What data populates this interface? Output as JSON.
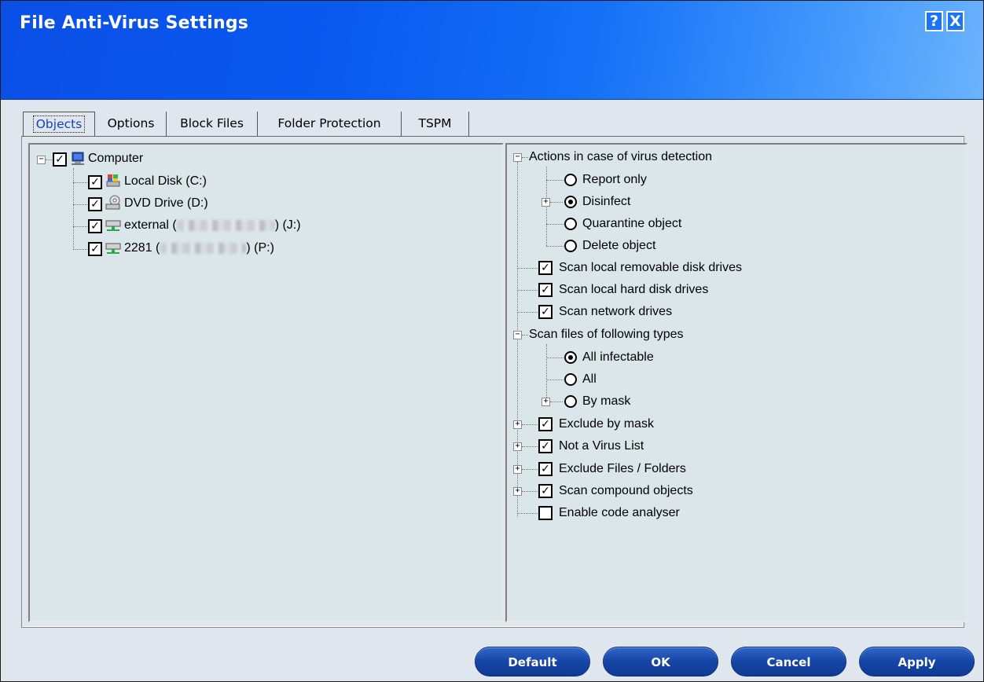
{
  "window": {
    "title": "File Anti-Virus Settings",
    "help_label": "?",
    "close_label": "X"
  },
  "tabs": [
    "Objects",
    "Options",
    "Block Files",
    "Folder Protection",
    "TSPM"
  ],
  "selected_tab": "Objects",
  "objects_tree": {
    "root": {
      "label": "Computer",
      "checked": true,
      "icon": "computer-icon"
    },
    "items": [
      {
        "label": "Local Disk (C:)",
        "checked": true,
        "icon": "local-disk-icon"
      },
      {
        "label": "DVD Drive (D:)",
        "checked": true,
        "icon": "dvd-drive-icon"
      },
      {
        "label_prefix": "external (",
        "label_suffix": ") (J:)",
        "checked": true,
        "icon": "network-drive-icon",
        "blurred": true
      },
      {
        "label_prefix": "2281 (",
        "label_suffix": ") (P:)",
        "checked": true,
        "icon": "network-drive-icon",
        "blurred": true
      }
    ]
  },
  "options_tree": {
    "actions": {
      "label": "Actions in case of virus detection",
      "options": [
        {
          "label": "Report only",
          "selected": false
        },
        {
          "label": "Disinfect",
          "selected": true,
          "expandable": true
        },
        {
          "label": "Quarantine object",
          "selected": false
        },
        {
          "label": "Delete object",
          "selected": false
        }
      ]
    },
    "scan_removable": {
      "label": "Scan local removable disk drives",
      "checked": true
    },
    "scan_hard": {
      "label": "Scan local hard disk drives",
      "checked": true
    },
    "scan_network": {
      "label": "Scan network drives",
      "checked": true
    },
    "file_types": {
      "label": "Scan files of following types",
      "options": [
        {
          "label": "All infectable",
          "selected": true
        },
        {
          "label": "All",
          "selected": false
        },
        {
          "label": "By mask",
          "selected": false,
          "expandable": true
        }
      ]
    },
    "exclude_mask": {
      "label": "Exclude by mask",
      "checked": true
    },
    "not_virus": {
      "label": "Not a Virus List",
      "checked": true
    },
    "exclude_files": {
      "label": "Exclude Files / Folders",
      "checked": true
    },
    "compound": {
      "label": "Scan compound objects",
      "checked": true
    },
    "code_analyser": {
      "label": "Enable code analyser",
      "checked": false
    }
  },
  "buttons": {
    "default": "Default",
    "ok": "OK",
    "cancel": "Cancel",
    "apply": "Apply"
  },
  "colors": {
    "titlebar_start": "#0b4fe6",
    "titlebar_end": "#6ab3fd",
    "pane_bg": "#dae6e9",
    "button": "#1646a6"
  }
}
